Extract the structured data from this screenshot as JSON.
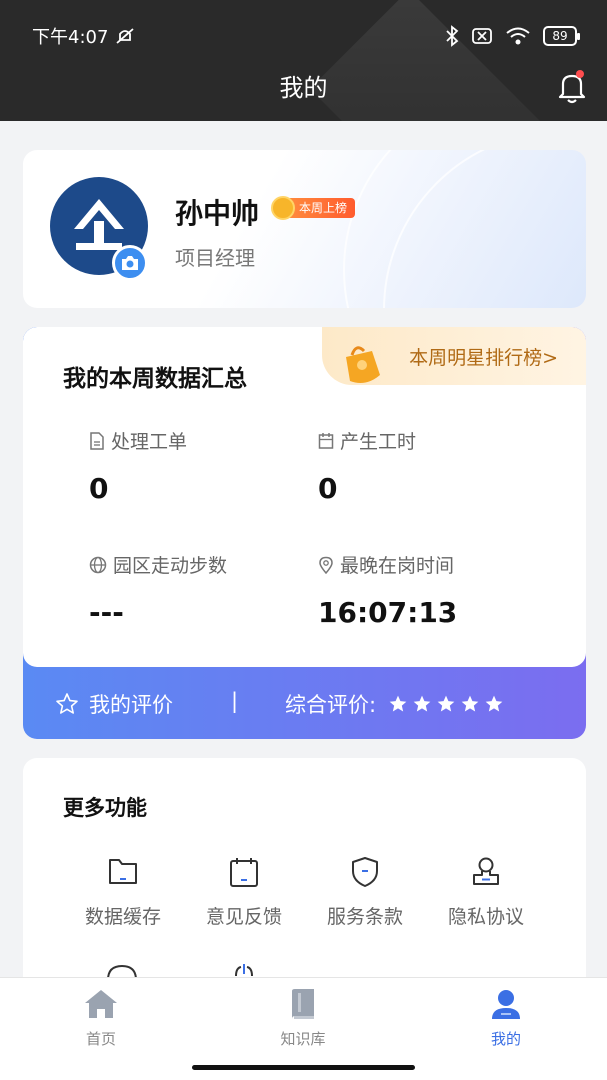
{
  "status_bar": {
    "time": "下午4:07",
    "battery": "89"
  },
  "header": {
    "title": "我的"
  },
  "profile": {
    "name": "孙中帅",
    "badge": "本周上榜",
    "role": "项目经理"
  },
  "weekly": {
    "title": "我的本周数据汇总",
    "star_rank_link": "本周明星排行榜>",
    "stats": [
      {
        "label": "处理工单",
        "value": "0",
        "icon": "document-icon"
      },
      {
        "label": "产生工时",
        "value": "0",
        "icon": "calendar-icon"
      },
      {
        "label": "园区走动步数",
        "value": "---",
        "icon": "globe-icon"
      },
      {
        "label": "最晚在岗时间",
        "value": "16:07:13",
        "icon": "location-pin-icon"
      }
    ],
    "evaluation": {
      "my_label": "我的评价",
      "separator": "|",
      "overall_label": "综合评价:",
      "stars": 5
    }
  },
  "more": {
    "title": "更多功能",
    "items": [
      {
        "label": "数据缓存",
        "icon": "folder-icon"
      },
      {
        "label": "意见反馈",
        "icon": "calendar-icon"
      },
      {
        "label": "服务条款",
        "icon": "shield-icon"
      },
      {
        "label": "隐私协议",
        "icon": "stamp-icon"
      }
    ]
  },
  "tabbar": {
    "tabs": [
      {
        "label": "首页",
        "icon": "home-icon"
      },
      {
        "label": "知识库",
        "icon": "book-icon"
      },
      {
        "label": "我的",
        "icon": "user-icon",
        "active": true
      }
    ]
  },
  "colors": {
    "accent": "#3b6fe4",
    "gradient_start": "#5a8af3",
    "gradient_end": "#7b6df0",
    "header_bg": "#2a2a2a"
  }
}
